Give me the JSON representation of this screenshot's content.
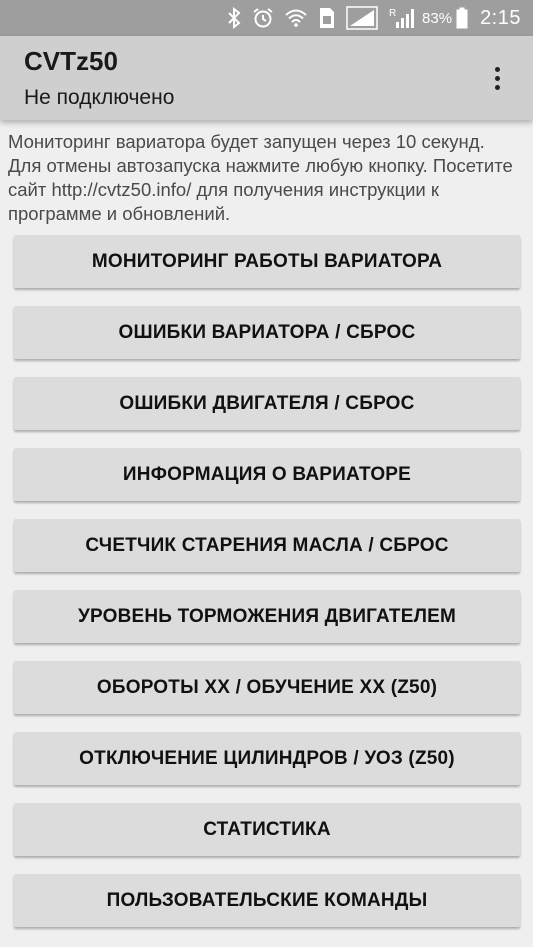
{
  "status_bar": {
    "battery_percent": "83%",
    "time": "2:15",
    "icons": [
      "bluetooth-icon",
      "alarm-icon",
      "wifi-icon",
      "sim-icon",
      "signal-icon",
      "roaming-signal-icon",
      "battery-icon"
    ],
    "roaming_label": "R"
  },
  "app_bar": {
    "title": "CVTz50",
    "subtitle": "Не подключено"
  },
  "info_text": "Мониторинг вариатора будет запущен через 10 секунд. Для отмены автозапуска нажмите любую кнопку. Посетите сайт http://cvtz50.info/ для получения инструкции к программе и обновлений.",
  "buttons": [
    "МОНИТОРИНГ РАБОТЫ ВАРИАТОРА",
    "ОШИБКИ ВАРИАТОРА / СБРОС",
    "ОШИБКИ ДВИГАТЕЛЯ / СБРОС",
    "ИНФОРМАЦИЯ О ВАРИАТОРЕ",
    "СЧЕТЧИК СТАРЕНИЯ МАСЛА / СБРОС",
    "УРОВЕНЬ ТОРМОЖЕНИЯ ДВИГАТЕЛЕМ",
    "ОБОРОТЫ ХХ / ОБУЧЕНИЕ ХХ (Z50)",
    "ОТКЛЮЧЕНИЕ ЦИЛИНДРОВ / УОЗ (Z50)",
    "СТАТИСТИКА",
    "ПОЛЬЗОВАТЕЛЬСКИЕ КОМАНДЫ"
  ]
}
